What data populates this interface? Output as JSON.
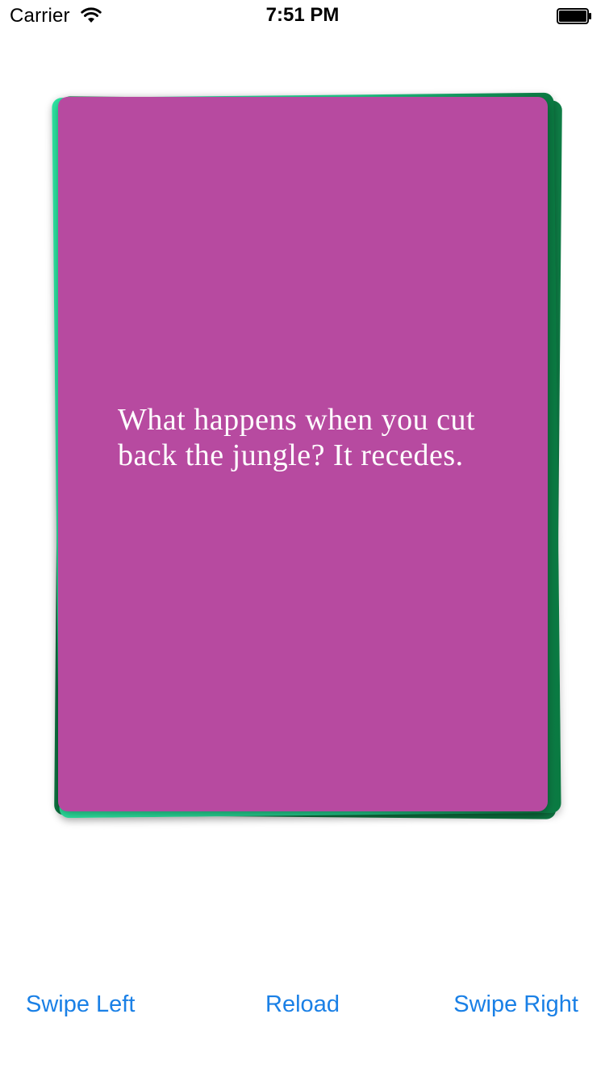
{
  "status_bar": {
    "carrier": "Carrier",
    "time": "7:51 PM",
    "wifi_icon": "wifi-icon",
    "battery_icon": "battery-full-icon"
  },
  "card": {
    "text": "What happens when you cut back the jungle?  It recedes.",
    "color": "#b74aa0",
    "text_color": "#ffffff",
    "back_card_colors": [
      "#2ee8a4",
      "#0f7d46"
    ]
  },
  "toolbar": {
    "swipe_left_label": "Swipe Left",
    "reload_label": "Reload",
    "swipe_right_label": "Swipe Right",
    "button_color": "#1a80e6"
  }
}
